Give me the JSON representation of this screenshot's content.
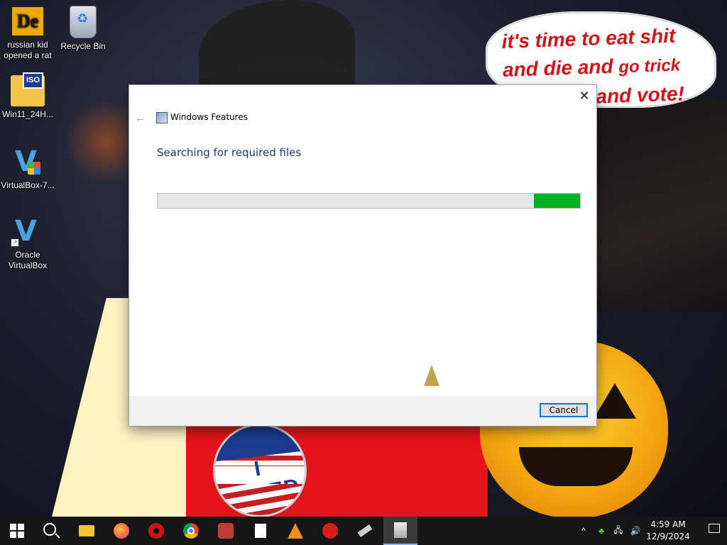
{
  "wallpaper": {
    "speech_line1": "it's time to eat shit",
    "speech_line2": "and die and",
    "speech_line2b": "go trick",
    "speech_line3": "and vote!",
    "sticker_text": "I VOTED"
  },
  "desktop_icons": [
    {
      "label": "russian kid opened a rat",
      "icon": "de-app-icon"
    },
    {
      "label": "Recycle Bin",
      "icon": "recycle-bin-icon"
    },
    {
      "label": "Win11_24H...",
      "icon": "iso-file-icon"
    },
    {
      "label": "VirtualBox-7...",
      "icon": "virtualbox-installer-icon"
    },
    {
      "label": "Oracle VirtualBox",
      "icon": "virtualbox-icon"
    }
  ],
  "dialog": {
    "title": "Windows Features",
    "heading": "Searching for required files",
    "progress_fraction": 0.11,
    "cancel_label": "Cancel",
    "close_glyph": "✕",
    "back_glyph": "←"
  },
  "taskbar": {
    "pinned": [
      "start-icon",
      "search-icon",
      "file-explorer-icon",
      "firefox-icon",
      "red-app-icon",
      "chrome-icon",
      "angry-birds-icon",
      "notepad-icon",
      "vlc-icon",
      "ladybug-app-icon",
      "usb-drive-icon",
      "installer-icon"
    ],
    "active_index": 11,
    "clock_time": "4:59 AM",
    "clock_date": "12/9/2024",
    "tray_chevron": "^",
    "volume_glyph": "🔊",
    "network_glyph": "🖧"
  },
  "colors": {
    "progress_fill": "#06b025",
    "heading_text": "#1f3a6e",
    "taskbar_bg": "#161616",
    "speech_text": "#d1141a"
  }
}
